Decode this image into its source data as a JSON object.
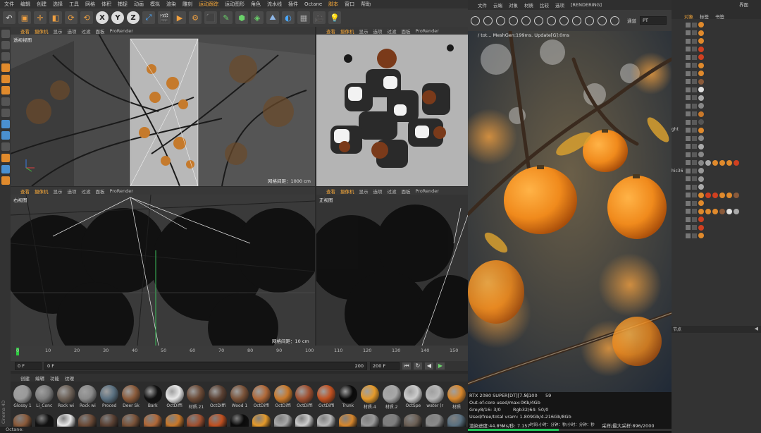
{
  "app": {
    "name": "Cinema 4D",
    "status_bar": "Octane:"
  },
  "menubar": {
    "items": [
      "文件",
      "编辑",
      "创建",
      "选择",
      "工具",
      "网格",
      "体积",
      "捕捉",
      "动画",
      "模拟",
      "渲染",
      "雕刻",
      "运动跟踪",
      "运动图形",
      "角色",
      "流水线",
      "插件",
      "Octane",
      "脚本",
      "窗口",
      "帮助"
    ],
    "highlight": [
      "运动跟踪",
      "脚本"
    ]
  },
  "toolbar": {
    "xyz": [
      "X",
      "Y",
      "Z"
    ]
  },
  "viewports": [
    {
      "menu": [
        "查看",
        "摄像机",
        "显示",
        "选项",
        "过滤",
        "面板",
        "ProRender"
      ],
      "label": "透视视图",
      "grid": ""
    },
    {
      "menu": [
        "查看",
        "摄像机",
        "显示",
        "选项",
        "过滤",
        "面板",
        "ProRender"
      ],
      "label": "",
      "grid": ""
    },
    {
      "menu": [
        "查看",
        "摄像机",
        "显示",
        "选项",
        "过滤",
        "面板",
        "ProRender"
      ],
      "label": "右视图",
      "grid": ""
    },
    {
      "menu": [
        "查看",
        "摄像机",
        "显示",
        "选项",
        "过滤",
        "面板",
        "ProRender"
      ],
      "label": "正视图",
      "grid": ""
    }
  ],
  "viewport_grid": [
    "网格间距：1000 cm",
    "网格间距：10 cm"
  ],
  "timeline": {
    "ticks": [
      "0",
      "10",
      "20",
      "30",
      "40",
      "50",
      "60",
      "70",
      "80",
      "90",
      "100",
      "110",
      "120",
      "130",
      "140",
      "150"
    ],
    "start": "0 F",
    "current": "0 F",
    "end": "200 F",
    "range_end": "200"
  },
  "material_menu": [
    "创建",
    "编辑",
    "功能",
    "纹理"
  ],
  "materials": [
    {
      "name": "Glossy 1",
      "color": "#9a9a9a"
    },
    {
      "name": "Li_Conc",
      "color": "#7d7d7d"
    },
    {
      "name": "Rock wi",
      "color": "#6b5f55"
    },
    {
      "name": "Rock wi",
      "color": "#8a8a8a"
    },
    {
      "name": "Proced",
      "color": "#5a7080"
    },
    {
      "name": "Deer Sk",
      "color": "#8a5a3a"
    },
    {
      "name": "Bark",
      "color": "#111111"
    },
    {
      "name": "OctDiffi",
      "color": "#e8e8e8"
    },
    {
      "name": "材质.21",
      "color": "#6b4a36"
    },
    {
      "name": "OctDiffi",
      "color": "#5a4032"
    },
    {
      "name": "Wood 1",
      "color": "#7a5238"
    },
    {
      "name": "OctDiffi",
      "color": "#b06838"
    },
    {
      "name": "OctDiffi",
      "color": "#c8782a"
    },
    {
      "name": "OctDiffi",
      "color": "#a05030"
    },
    {
      "name": "OctDiffi",
      "color": "#c05020"
    },
    {
      "name": "Trunk",
      "color": "#0a0a0a"
    },
    {
      "name": "材质.4",
      "color": "#e59a2a"
    },
    {
      "name": "材质.2",
      "color": "#a8a8a8"
    },
    {
      "name": "OctSpe",
      "color": "#cccccc"
    },
    {
      "name": "water (r",
      "color": "#b8b8b8"
    },
    {
      "name": "材质",
      "color": "#d6862c"
    }
  ],
  "render_view": {
    "menu": [
      "文件",
      "云端",
      "对象",
      "材质",
      "比较",
      "选项",
      "[RENDERING]"
    ],
    "title_partial": "",
    "channel_label": "通道",
    "channel_value": "PT",
    "info": "/ tot... MeshGen:199ms. Update[G]:0ms",
    "stats": {
      "gpu": "RTX 2080 SUPER[DT][7.5]",
      "gpu_pct": "%100",
      "gpu_temp": "59",
      "out_of_core": "Out-of-core used/max:0Kb/4Gb",
      "grey": "Grey8/16: 3/0",
      "rgb": "Rgb32/64: 50/0",
      "vram": "Used/free/total vram: 1.809Gb/4.216Gb/8Gb",
      "progress_label": "渲染进度:44.8%",
      "ms": "Ms/秒: 7.157",
      "time": "时间:小时：分钟：秒/小时：分钟：秒",
      "samples": "采样/最大采样:896/2000",
      "tail": "三角面"
    },
    "progress": 0.448
  },
  "right_panel": {
    "tabs": [
      "对象",
      "标签",
      "书签"
    ],
    "top_label": "界面",
    "partial_labels": [
      "ght",
      "hic36"
    ],
    "side_label": "节点"
  },
  "colors": {
    "accent": "#f4a73a",
    "bg": "#2a2a2a",
    "progress_green": "#22c45a"
  }
}
